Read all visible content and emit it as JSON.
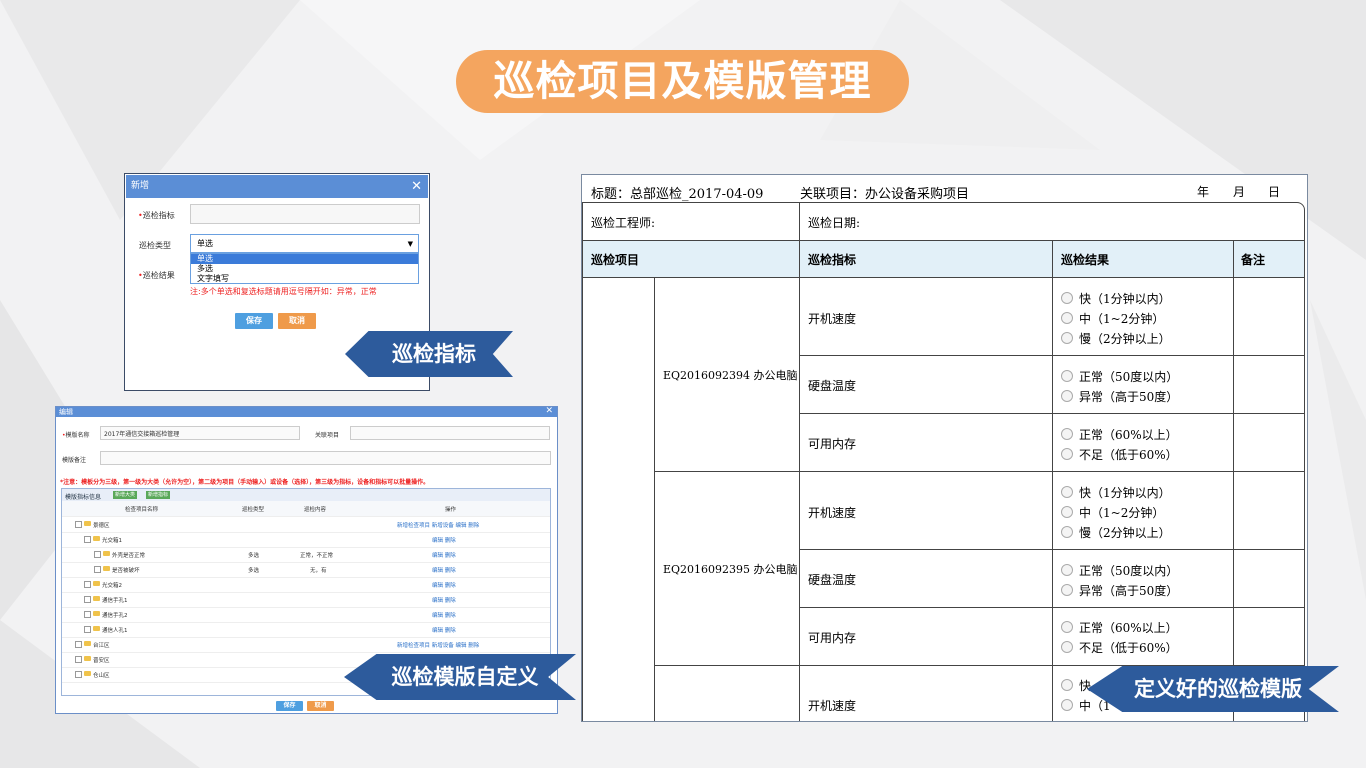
{
  "slide_title": "巡检项目及模版管理",
  "callouts": {
    "indicator": "巡检指标",
    "template_custom": "巡检模版自定义",
    "template_ready": "定义好的巡检模版"
  },
  "colors": {
    "accent_orange": "#f4a55f",
    "callout_blue": "#2d5b9c",
    "dialog_header": "#5b8ed6"
  },
  "dialog_new": {
    "title": "新增",
    "close": "✕",
    "field_indicator_label": "巡检指标",
    "field_type_label": "巡检类型",
    "type_selected": "单选",
    "type_options": [
      "单选",
      "多选",
      "文字填写"
    ],
    "field_result_label": "巡检结果",
    "note": "注:多个单选和复选标题请用逗号隔开如：异常，正常",
    "save": "保存",
    "cancel": "取消"
  },
  "dialog_edit": {
    "title": "编辑",
    "close": "✕",
    "template_name_label": "模版名称",
    "template_name_value": "2017年通信交接箱巡检管理",
    "related_project_label": "关联项目",
    "template_remark_label": "模版备注",
    "warning": "*注意：模板分为三级，第一级为大类（允许为空），第二级为项目（手动输入）或设备（选择），第三级为指标，设备和指标可以批量操作。",
    "panel_title": "模版指标信息",
    "add_category": "新增大类",
    "add_indicator": "新增指标",
    "columns": [
      "检查项目名称",
      "巡检类型",
      "巡检内容",
      "操作"
    ],
    "rows": [
      {
        "name": "景德区",
        "type": "",
        "content": "",
        "ops": "新增检查项目  新增设备  编辑  删除"
      },
      {
        "name": "光交箱1",
        "type": "",
        "content": "",
        "ops": "编辑  删除"
      },
      {
        "name": "外壳是否正常",
        "type": "多选",
        "content": "正常，不正常",
        "ops": "编辑  删除"
      },
      {
        "name": "是否被破坏",
        "type": "多选",
        "content": "无，有",
        "ops": "编辑  删除"
      },
      {
        "name": "光交箱2",
        "type": "",
        "content": "",
        "ops": "编辑  删除"
      },
      {
        "name": "通信手孔1",
        "type": "",
        "content": "",
        "ops": "编辑  删除"
      },
      {
        "name": "通信手孔2",
        "type": "",
        "content": "",
        "ops": "编辑  删除"
      },
      {
        "name": "通信人孔1",
        "type": "",
        "content": "",
        "ops": "编辑  删除"
      },
      {
        "name": "台江区",
        "type": "",
        "content": "",
        "ops": "新增检查项目  新增设备  编辑  删除"
      },
      {
        "name": "晋安区",
        "type": "",
        "content": "",
        "ops": ""
      },
      {
        "name": "仓山区",
        "type": "",
        "content": "",
        "ops": ""
      }
    ],
    "save": "保存",
    "cancel": "取消"
  },
  "template_form": {
    "title": "标题：总部巡检_2017-04-09",
    "project": "关联项目：办公设备采购项目",
    "date_year": "年",
    "date_month": "月",
    "date_day": "日",
    "engineer_label": "巡检工程师:",
    "date_label": "巡检日期:",
    "headers": [
      "巡检项目",
      "巡检指标",
      "巡检结果",
      "备注"
    ],
    "devices": [
      "EQ2016092394 办公电脑",
      "EQ2016092395 办公电脑"
    ],
    "indicator_names": [
      "开机速度",
      "硬盘温度",
      "可用内存"
    ],
    "options_speed": [
      "快（1分钟以内）",
      "中（1~2分钟）",
      "慢（2分钟以上）"
    ],
    "options_temp": [
      "正常（50度以内）",
      "异常（高于50度）"
    ],
    "options_mem": [
      "正常（60%以上）",
      "不足（低于60%）"
    ],
    "partial_options": [
      "快",
      "中（1"
    ]
  }
}
